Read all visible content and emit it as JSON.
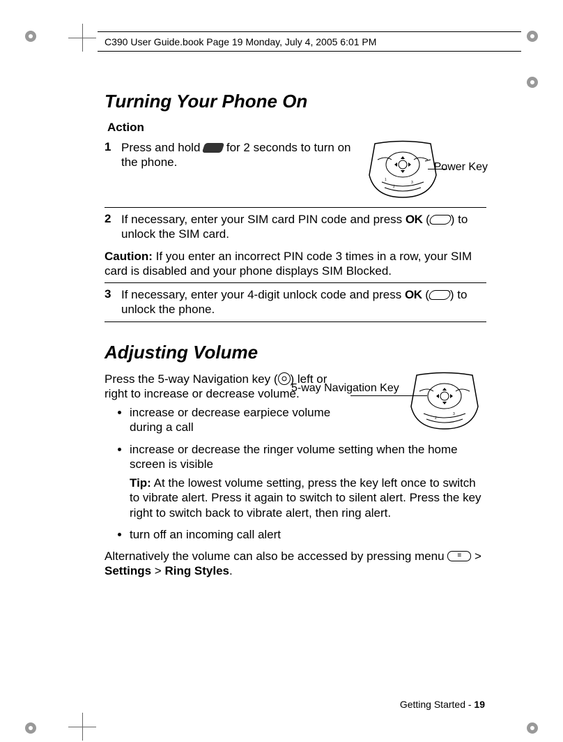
{
  "header": "C390 User Guide.book  Page 19  Monday, July 4, 2005  6:01 PM",
  "section1": {
    "title": "Turning Your Phone On",
    "action_label": "Action",
    "step1": {
      "num": "1",
      "text_before": "Press and hold ",
      "text_after": " for 2 seconds to turn on the phone.",
      "img_label": "Power Key"
    },
    "step2": {
      "num": "2",
      "text_before": "If necessary, enter your SIM card PIN code and press ",
      "ok": "OK",
      "text_paren_open": " (",
      "text_paren_close": ") to unlock the SIM card."
    },
    "caution": {
      "label": "Caution:",
      "text": " If you enter an incorrect PIN code 3 times in a row, your SIM card is disabled and your phone displays SIM Blocked."
    },
    "step3": {
      "num": "3",
      "text_before": "If necessary, enter your 4-digit unlock code and press ",
      "ok": "OK",
      "text_paren_open": " (",
      "text_paren_close": ") to unlock the phone."
    }
  },
  "section2": {
    "title": "Adjusting Volume",
    "intro_before": "Press the 5-way Navigation key (",
    "intro_after": ") left or right to increase or decrease volume.",
    "img_label": "5-way Navigation Key",
    "bullet1": "increase or decrease earpiece volume during a call",
    "bullet2": "increase or decrease the ringer volume setting when the home screen is visible",
    "tip_label": "Tip:",
    "tip_text": " At the lowest volume setting, press the key left once to switch to vibrate alert. Press it again to switch to silent alert. Press the key right to switch back to vibrate alert, then ring alert.",
    "bullet3": "turn off an incoming call alert",
    "alt_before": "Alternatively the volume can also be accessed by pressing menu ",
    "alt_gt1": " > ",
    "alt_settings": "Settings",
    "alt_gt2": " > ",
    "alt_ring": "Ring Styles",
    "alt_period": "."
  },
  "footer": {
    "text": "Getting Started - ",
    "page": "19"
  }
}
